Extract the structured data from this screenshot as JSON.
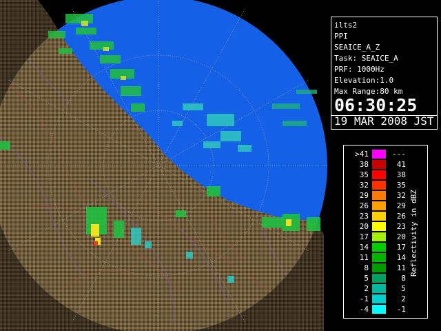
{
  "info": {
    "station": "ilts2",
    "mode": "PPI",
    "product": "SEAICE_A_Z",
    "task": "Task: SEAICE_A",
    "prf": "PRF: 1000Hz",
    "elevation": "Elevation:1.0",
    "max_range": "Max Range:80 km",
    "time": "06:30:25",
    "date": "19 MAR 2008 JST"
  },
  "legend": {
    "title": "Reflectivity in dBZ",
    "rows": [
      {
        "lo": ">41",
        "hi": "---",
        "color": "#ff00ff"
      },
      {
        "lo": "38",
        "hi": "41",
        "color": "#c80000"
      },
      {
        "lo": "35",
        "hi": "38",
        "color": "#ff0000"
      },
      {
        "lo": "32",
        "hi": "35",
        "color": "#ff3000"
      },
      {
        "lo": "29",
        "hi": "32",
        "color": "#ff7800"
      },
      {
        "lo": "26",
        "hi": "29",
        "color": "#ffa000"
      },
      {
        "lo": "23",
        "hi": "26",
        "color": "#ffd000"
      },
      {
        "lo": "20",
        "hi": "23",
        "color": "#ffff00"
      },
      {
        "lo": "17",
        "hi": "20",
        "color": "#a0f000"
      },
      {
        "lo": "14",
        "hi": "17",
        "color": "#00d000"
      },
      {
        "lo": "11",
        "hi": "14",
        "color": "#00b400"
      },
      {
        "lo": "8",
        "hi": "11",
        "color": "#009c00"
      },
      {
        "lo": "5",
        "hi": "8",
        "color": "#00a060"
      },
      {
        "lo": "2",
        "hi": "5",
        "color": "#00b8a0"
      },
      {
        "lo": "-1",
        "hi": "2",
        "color": "#00d0d0"
      },
      {
        "lo": "-4",
        "hi": "-1",
        "color": "#00ffff"
      }
    ]
  },
  "colors": {
    "sea": "#1460e6",
    "sea_outer": "#0018c8",
    "land_dark": "#5a4a30",
    "land_light": "#a08a62",
    "grid": "#8a8a8a"
  }
}
